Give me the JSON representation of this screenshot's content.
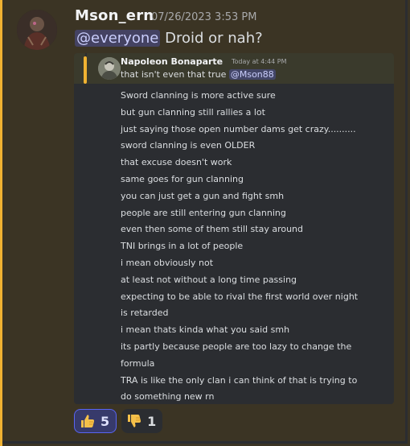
{
  "message": {
    "author": "Mson_ern",
    "timestamp": "07/26/2023 3:53 PM",
    "mention": "@everyone",
    "text": "Droid or nah?"
  },
  "embed": {
    "reply": {
      "author": "Napoleon Bonaparte",
      "time": "Today at 4:44 PM",
      "text": "that isn't even that true",
      "mention": "@Mson88"
    },
    "lines": [
      "Sword clanning is more active sure",
      "but gun clanning still rallies a lot",
      "just saying those open number dams get crazy..........",
      "sword clanning is even OLDER",
      "that excuse doesn't work",
      "same goes for gun clanning",
      "you can just get a gun and fight smh",
      "people are still entering gun clanning",
      "even then some of them still stay around",
      "TNI brings in a lot of people",
      "i mean obviously not",
      "at least not without a long time passing",
      "expecting to be able to rival the first world over night",
      "is retarded",
      "i mean thats kinda what you said smh",
      "its partly because people are too lazy to change the",
      "formula",
      "TRA is like the only clan i can think of that is trying to",
      "do something new rn"
    ]
  },
  "reactions": [
    {
      "emoji": "thumbs-up-icon",
      "count": "5",
      "active": true
    },
    {
      "emoji": "thumbs-down-icon",
      "count": "1",
      "active": false
    }
  ],
  "colors": {
    "background": "#3b3424",
    "highlight": "#f0b232",
    "embed": "#2b2d31",
    "mention_bg": "#4a4f8a",
    "accent": "#5865f2"
  }
}
